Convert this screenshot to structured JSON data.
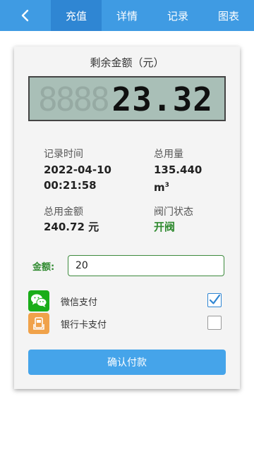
{
  "nav": {
    "tabs": [
      {
        "label": "充值",
        "active": true
      },
      {
        "label": "详情",
        "active": false
      },
      {
        "label": "记录",
        "active": false
      },
      {
        "label": "图表",
        "active": false
      }
    ],
    "back_icon": "chevron-left-icon"
  },
  "card": {
    "title": "剩余金额（元）",
    "balance_ghost": "8888",
    "balance": "23.32"
  },
  "info": {
    "record_time_label": "记录时间",
    "record_date": "2022-04-10",
    "record_time": "00:21:58",
    "total_usage_label": "总用量",
    "total_usage_value": "135.440",
    "total_usage_unit": "m",
    "total_usage_unit_sup": "3",
    "total_amount_label": "总用金额",
    "total_amount_value": "240.72 元",
    "valve_status_label": "阀门状态",
    "valve_status_value": "开阀"
  },
  "payment": {
    "amount_label": "金额:",
    "amount_value": "20",
    "methods": [
      {
        "label": "微信支付",
        "icon": "wechat-icon",
        "checked": true
      },
      {
        "label": "银行卡支付",
        "icon": "bank-card-icon",
        "checked": false
      }
    ],
    "confirm_label": "确认付款"
  },
  "colors": {
    "nav_bg": "#3f9be3",
    "nav_active": "#2f86d3",
    "wechat_green": "#1aad19",
    "bank_orange": "#f0a24a",
    "valve_green": "#2f8a2f",
    "button_blue": "#45a4ea"
  }
}
